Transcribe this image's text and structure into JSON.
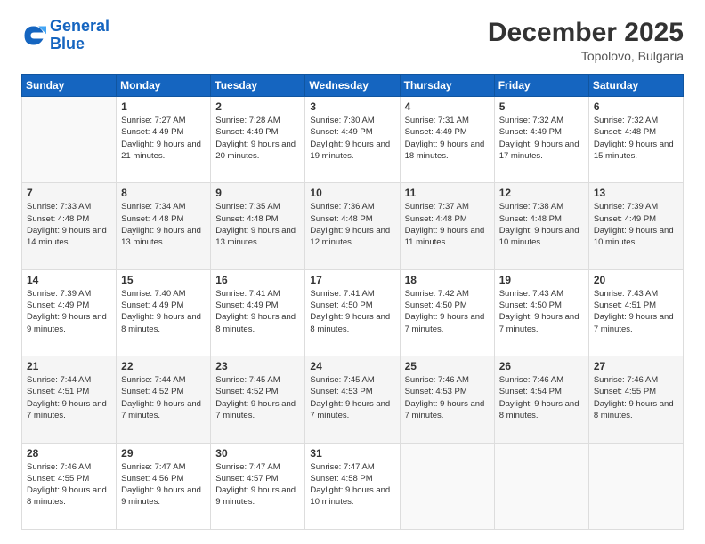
{
  "logo": {
    "text_general": "General",
    "text_blue": "Blue"
  },
  "header": {
    "month": "December 2025",
    "location": "Topolovo, Bulgaria"
  },
  "days_of_week": [
    "Sunday",
    "Monday",
    "Tuesday",
    "Wednesday",
    "Thursday",
    "Friday",
    "Saturday"
  ],
  "weeks": [
    [
      {
        "day": "",
        "empty": true
      },
      {
        "day": "1",
        "sunrise": "7:27 AM",
        "sunset": "4:49 PM",
        "daylight": "9 hours and 21 minutes."
      },
      {
        "day": "2",
        "sunrise": "7:28 AM",
        "sunset": "4:49 PM",
        "daylight": "9 hours and 20 minutes."
      },
      {
        "day": "3",
        "sunrise": "7:30 AM",
        "sunset": "4:49 PM",
        "daylight": "9 hours and 19 minutes."
      },
      {
        "day": "4",
        "sunrise": "7:31 AM",
        "sunset": "4:49 PM",
        "daylight": "9 hours and 18 minutes."
      },
      {
        "day": "5",
        "sunrise": "7:32 AM",
        "sunset": "4:49 PM",
        "daylight": "9 hours and 17 minutes."
      },
      {
        "day": "6",
        "sunrise": "7:32 AM",
        "sunset": "4:48 PM",
        "daylight": "9 hours and 15 minutes."
      }
    ],
    [
      {
        "day": "7",
        "sunrise": "7:33 AM",
        "sunset": "4:48 PM",
        "daylight": "9 hours and 14 minutes."
      },
      {
        "day": "8",
        "sunrise": "7:34 AM",
        "sunset": "4:48 PM",
        "daylight": "9 hours and 13 minutes."
      },
      {
        "day": "9",
        "sunrise": "7:35 AM",
        "sunset": "4:48 PM",
        "daylight": "9 hours and 13 minutes."
      },
      {
        "day": "10",
        "sunrise": "7:36 AM",
        "sunset": "4:48 PM",
        "daylight": "9 hours and 12 minutes."
      },
      {
        "day": "11",
        "sunrise": "7:37 AM",
        "sunset": "4:48 PM",
        "daylight": "9 hours and 11 minutes."
      },
      {
        "day": "12",
        "sunrise": "7:38 AM",
        "sunset": "4:48 PM",
        "daylight": "9 hours and 10 minutes."
      },
      {
        "day": "13",
        "sunrise": "7:39 AM",
        "sunset": "4:49 PM",
        "daylight": "9 hours and 10 minutes."
      }
    ],
    [
      {
        "day": "14",
        "sunrise": "7:39 AM",
        "sunset": "4:49 PM",
        "daylight": "9 hours and 9 minutes."
      },
      {
        "day": "15",
        "sunrise": "7:40 AM",
        "sunset": "4:49 PM",
        "daylight": "9 hours and 8 minutes."
      },
      {
        "day": "16",
        "sunrise": "7:41 AM",
        "sunset": "4:49 PM",
        "daylight": "9 hours and 8 minutes."
      },
      {
        "day": "17",
        "sunrise": "7:41 AM",
        "sunset": "4:50 PM",
        "daylight": "9 hours and 8 minutes."
      },
      {
        "day": "18",
        "sunrise": "7:42 AM",
        "sunset": "4:50 PM",
        "daylight": "9 hours and 7 minutes."
      },
      {
        "day": "19",
        "sunrise": "7:43 AM",
        "sunset": "4:50 PM",
        "daylight": "9 hours and 7 minutes."
      },
      {
        "day": "20",
        "sunrise": "7:43 AM",
        "sunset": "4:51 PM",
        "daylight": "9 hours and 7 minutes."
      }
    ],
    [
      {
        "day": "21",
        "sunrise": "7:44 AM",
        "sunset": "4:51 PM",
        "daylight": "9 hours and 7 minutes."
      },
      {
        "day": "22",
        "sunrise": "7:44 AM",
        "sunset": "4:52 PM",
        "daylight": "9 hours and 7 minutes."
      },
      {
        "day": "23",
        "sunrise": "7:45 AM",
        "sunset": "4:52 PM",
        "daylight": "9 hours and 7 minutes."
      },
      {
        "day": "24",
        "sunrise": "7:45 AM",
        "sunset": "4:53 PM",
        "daylight": "9 hours and 7 minutes."
      },
      {
        "day": "25",
        "sunrise": "7:46 AM",
        "sunset": "4:53 PM",
        "daylight": "9 hours and 7 minutes."
      },
      {
        "day": "26",
        "sunrise": "7:46 AM",
        "sunset": "4:54 PM",
        "daylight": "9 hours and 8 minutes."
      },
      {
        "day": "27",
        "sunrise": "7:46 AM",
        "sunset": "4:55 PM",
        "daylight": "9 hours and 8 minutes."
      }
    ],
    [
      {
        "day": "28",
        "sunrise": "7:46 AM",
        "sunset": "4:55 PM",
        "daylight": "9 hours and 8 minutes."
      },
      {
        "day": "29",
        "sunrise": "7:47 AM",
        "sunset": "4:56 PM",
        "daylight": "9 hours and 9 minutes."
      },
      {
        "day": "30",
        "sunrise": "7:47 AM",
        "sunset": "4:57 PM",
        "daylight": "9 hours and 9 minutes."
      },
      {
        "day": "31",
        "sunrise": "7:47 AM",
        "sunset": "4:58 PM",
        "daylight": "9 hours and 10 minutes."
      },
      {
        "day": "",
        "empty": true
      },
      {
        "day": "",
        "empty": true
      },
      {
        "day": "",
        "empty": true
      }
    ]
  ],
  "labels": {
    "sunrise_prefix": "Sunrise: ",
    "sunset_prefix": "Sunset: ",
    "daylight_prefix": "Daylight: "
  }
}
